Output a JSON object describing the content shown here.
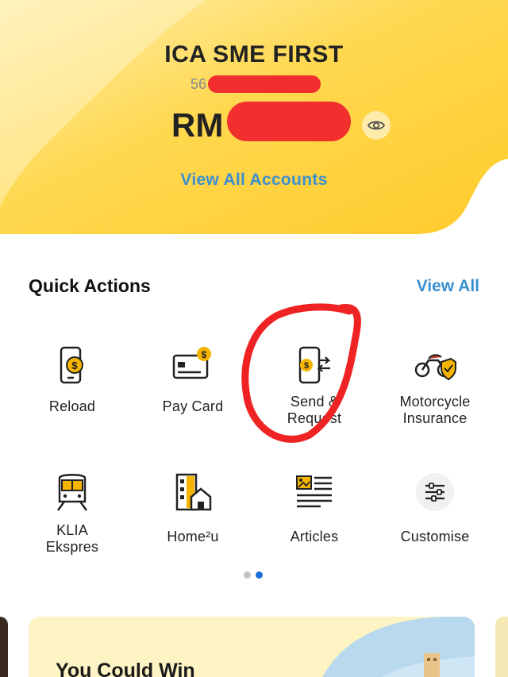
{
  "account": {
    "name": "ICA SME FIRST",
    "number_visible": "56",
    "currency": "RM",
    "view_all_accounts": "View All Accounts"
  },
  "quick_actions": {
    "title": "Quick Actions",
    "view_all": "View All",
    "items": [
      {
        "label": "Reload",
        "icon": "phone-dollar-icon"
      },
      {
        "label": "Pay Card",
        "icon": "credit-card-icon"
      },
      {
        "label": "Send &\nRequest",
        "icon": "send-request-icon"
      },
      {
        "label": "Motorcycle\nInsurance",
        "icon": "motorcycle-shield-icon"
      },
      {
        "label": "KLIA\nEkspres",
        "icon": "train-icon"
      },
      {
        "label": "Home²u",
        "icon": "home-building-icon"
      },
      {
        "label": "Articles",
        "icon": "articles-icon"
      },
      {
        "label": "Customise",
        "icon": "sliders-icon"
      }
    ],
    "pager": {
      "pages": 2,
      "active": 2
    }
  },
  "promo": {
    "title": "You Could Win"
  },
  "colors": {
    "accent_blue": "#3a8fd0",
    "brand_yellow": "#ffcb2b",
    "redaction": "#f22f2f",
    "pager_active": "#1c6fd6",
    "pager_inactive": "#c4c4c4"
  }
}
